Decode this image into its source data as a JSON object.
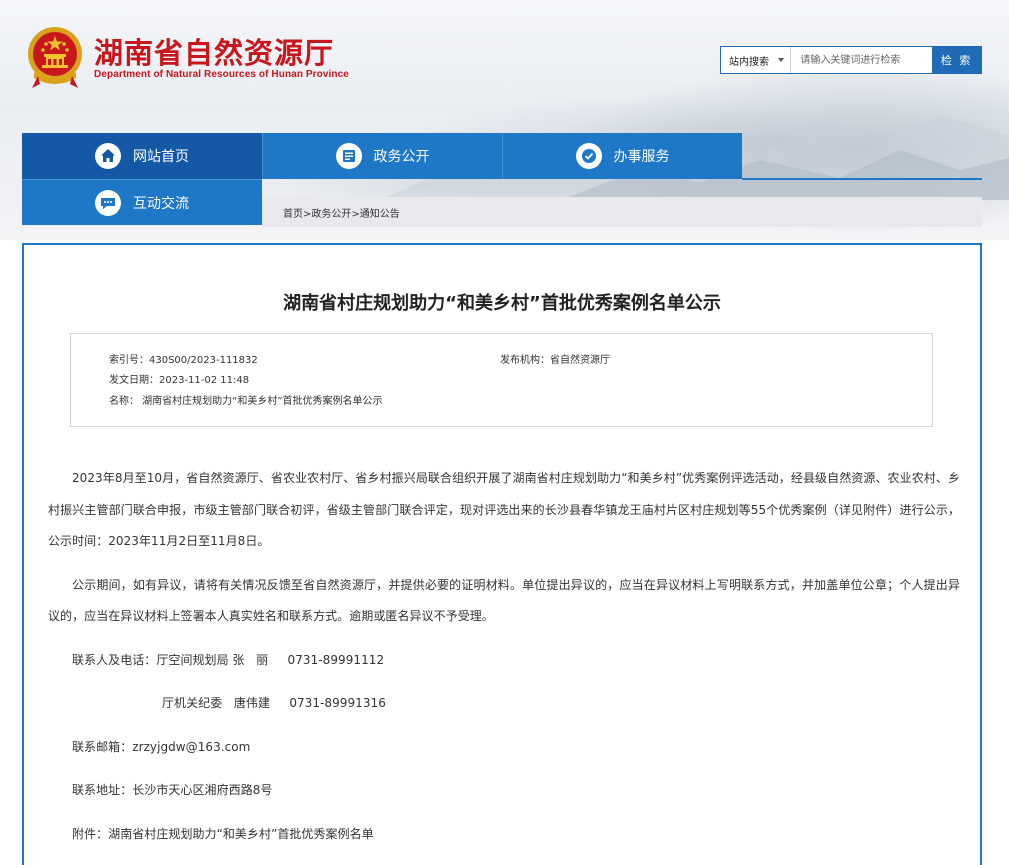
{
  "header": {
    "title": "湖南省自然资源厅",
    "subtitle": "Department of Natural Resources of Hunan Province",
    "emblem_icon": "national-emblem-icon",
    "brand_color": "#c8161d"
  },
  "search": {
    "scope": "站内搜索",
    "placeholder": "请输入关键词进行检索",
    "button": "检 索"
  },
  "nav": {
    "items": [
      {
        "label": "网站首页",
        "icon": "home-icon"
      },
      {
        "label": "政务公开",
        "icon": "document-icon"
      },
      {
        "label": "办事服务",
        "icon": "service-icon"
      },
      {
        "label": "互动交流",
        "icon": "chat-icon"
      }
    ],
    "accent": "#1f78c7"
  },
  "breadcrumb": "首页>政务公开>通知公告",
  "article": {
    "title": "湖南省村庄规划助力“和美乡村”首批优秀案例名单公示",
    "meta": {
      "index_no": "索引号：430S00/2023-111832",
      "publisher": "发布机构：省自然资源厅",
      "date": "发文日期：2023-11-02 11:48",
      "name": "名称：  湖南省村庄规划助力“和美乡村”首批优秀案例名单公示"
    },
    "paragraphs": [
      "2023年8月至10月，省自然资源厅、省农业农村厅、省乡村振兴局联合组织开展了湖南省村庄规划助力“和美乡村”优秀案例评选活动，经县级自然资源、农业农村、乡村振兴主管部门联合申报，市级主管部门联合初评，省级主管部门联合评定，现对评选出来的长沙县春华镇龙王庙村片区村庄规划等55个优秀案例（详见附件）进行公示，公示时间：2023年11月2日至11月8日。",
      "公示期间，如有异议，请将有关情况反馈至省自然资源厅，并提供必要的证明材料。单位提出异议的，应当在异议材料上写明联系方式，并加盖单位公章；个人提出异议的，应当在异议材料上签署本人真实姓名和联系方式。逾期或匿名异议不予受理。"
    ],
    "contact1": "联系人及电话：厅空间规划局 张   丽     0731-89991112",
    "contact2": "厅机关纪委   唐伟建     0731-89991316",
    "email": "联系邮箱：zrzyjgdw@163.com",
    "address": "联系地址：长沙市天心区湘府西路8号",
    "attachment": "附件：湖南省村庄规划助力“和美乡村”首批优秀案例名单"
  }
}
